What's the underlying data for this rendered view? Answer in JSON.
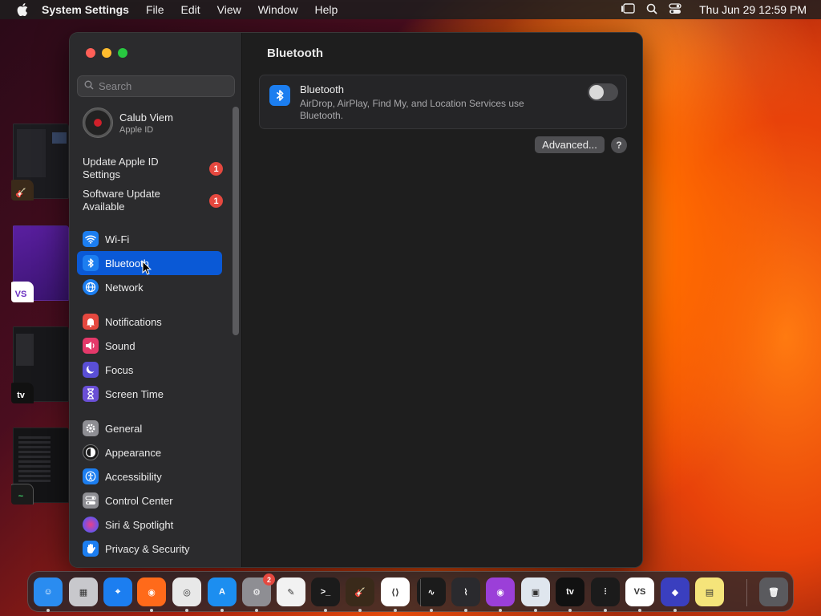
{
  "menubar": {
    "app_name": "System Settings",
    "menus": [
      "File",
      "Edit",
      "View",
      "Window",
      "Help"
    ],
    "clock": "Thu Jun 29  12:59 PM"
  },
  "sidebar": {
    "search_placeholder": "Search",
    "profile": {
      "name": "Calub Viem",
      "subtitle": "Apple ID"
    },
    "notices": [
      {
        "label": "Update Apple ID Settings",
        "badge": "1"
      },
      {
        "label": "Software Update Available",
        "badge": "1"
      }
    ],
    "items": [
      {
        "label": "Wi-Fi",
        "icon": "wifi-icon",
        "color": "#1c7ef0"
      },
      {
        "label": "Bluetooth",
        "icon": "bluetooth-icon",
        "color": "#1c7ef0",
        "selected": true
      },
      {
        "label": "Network",
        "icon": "globe-icon",
        "color": "#1c7ef0"
      },
      {
        "label": "Notifications",
        "icon": "bell-icon",
        "color": "#e5483f"
      },
      {
        "label": "Sound",
        "icon": "speaker-icon",
        "color": "#e5396a"
      },
      {
        "label": "Focus",
        "icon": "moon-icon",
        "color": "#5a4fd6"
      },
      {
        "label": "Screen Time",
        "icon": "hourglass-icon",
        "color": "#6a4fd6"
      },
      {
        "label": "General",
        "icon": "gear-icon",
        "color": "#8e8e93"
      },
      {
        "label": "Appearance",
        "icon": "appearance-icon",
        "color": "#1a1a1a"
      },
      {
        "label": "Accessibility",
        "icon": "accessibility-icon",
        "color": "#1c7ef0"
      },
      {
        "label": "Control Center",
        "icon": "control-center-icon",
        "color": "#8e8e93"
      },
      {
        "label": "Siri & Spotlight",
        "icon": "siri-icon",
        "color": "#7a4fe0"
      },
      {
        "label": "Privacy & Security",
        "icon": "hand-icon",
        "color": "#1c7ef0"
      }
    ]
  },
  "content": {
    "title": "Bluetooth",
    "card": {
      "title": "Bluetooth",
      "description": "AirDrop, AirPlay, Find My, and Location Services use Bluetooth.",
      "toggle_on": false
    },
    "advanced_label": "Advanced...",
    "help_label": "?"
  },
  "stage_apps": [
    {
      "name": "garageband-icon",
      "label": "🎸"
    },
    {
      "name": "visual-studio-icon",
      "label": "VS"
    },
    {
      "name": "apple-tv-icon",
      "label": "tv"
    },
    {
      "name": "activity-monitor-icon",
      "label": "~"
    }
  ],
  "dock": {
    "settings_badge": "2",
    "apps": [
      {
        "name": "finder-icon",
        "color": "#2a8cf0",
        "glyph": "☺"
      },
      {
        "name": "launchpad-icon",
        "color": "#c8c8cc",
        "glyph": "▦"
      },
      {
        "name": "safari-icon",
        "color": "#1c7ef0",
        "glyph": "⌖"
      },
      {
        "name": "firefox-icon",
        "color": "#ff6a1a",
        "glyph": "◉"
      },
      {
        "name": "chrome-icon",
        "color": "#e8e8e8",
        "glyph": "◎"
      },
      {
        "name": "app-store-icon",
        "color": "#1c8ef0",
        "glyph": "A"
      },
      {
        "name": "system-settings-icon",
        "color": "#8e8e93",
        "glyph": "⚙"
      },
      {
        "name": "textedit-icon",
        "color": "#f2f2f2",
        "glyph": "✎"
      },
      {
        "name": "terminal-icon",
        "color": "#1b1b1b",
        "glyph": ">_"
      },
      {
        "name": "garageband-icon",
        "color": "#3a2a1a",
        "glyph": "🎸"
      },
      {
        "name": "vscode-icon",
        "color": "#ffffff",
        "glyph": "⟨⟩"
      },
      {
        "name": "activity-monitor-icon",
        "color": "#1b1b1b",
        "glyph": "∿"
      },
      {
        "name": "stocks-icon",
        "color": "#2a2a2e",
        "glyph": "⌇"
      },
      {
        "name": "podcasts-icon",
        "color": "#9b3fd8",
        "glyph": "◉"
      },
      {
        "name": "preview-icon",
        "color": "#dfe6ee",
        "glyph": "▣"
      },
      {
        "name": "apple-tv-icon",
        "color": "#111111",
        "glyph": "tv"
      },
      {
        "name": "voice-memos-icon",
        "color": "#1b1b1b",
        "glyph": "⫶"
      },
      {
        "name": "visual-studio-icon",
        "color": "#ffffff",
        "glyph": "VS"
      },
      {
        "name": "shortcuts-icon",
        "color": "#3a3fbf",
        "glyph": "◆"
      },
      {
        "name": "stickies-icon",
        "color": "#f5e47a",
        "glyph": "▤"
      },
      {
        "name": "trash-icon",
        "color": "#5a5a5e",
        "glyph": "🗑"
      }
    ]
  }
}
